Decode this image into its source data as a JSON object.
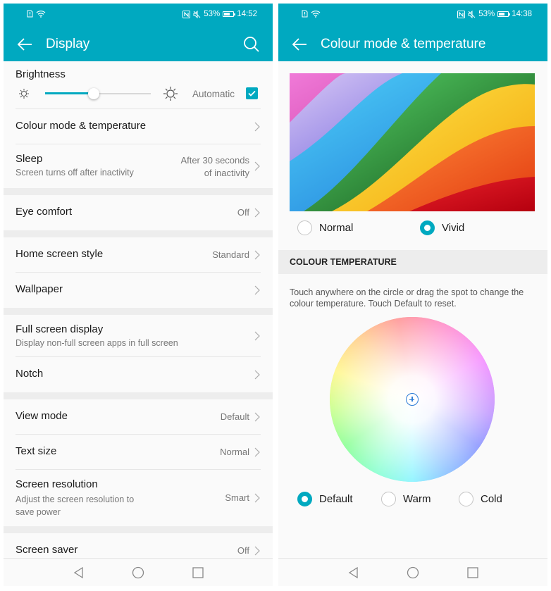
{
  "accent_color": "#00a9c0",
  "left_screen": {
    "status_bar": {
      "battery_percent": "53%",
      "time": "14:52"
    },
    "app_bar": {
      "title": "Display",
      "back_icon": "arrow-left-icon",
      "search_icon": "search-icon"
    },
    "brightness": {
      "title": "Brightness",
      "level_fraction": 0.46,
      "automatic_label": "Automatic",
      "automatic_checked": true
    },
    "rows": {
      "colour_mode": {
        "title": "Colour mode & temperature"
      },
      "sleep": {
        "title": "Sleep",
        "subtitle": "Screen turns off after inactivity",
        "value_line1": "After 30 seconds",
        "value_line2": "of inactivity"
      },
      "eye_comfort": {
        "title": "Eye comfort",
        "value": "Off"
      },
      "home_screen_style": {
        "title": "Home screen style",
        "value": "Standard"
      },
      "wallpaper": {
        "title": "Wallpaper"
      },
      "full_screen_display": {
        "title": "Full screen display",
        "subtitle": "Display non-full screen apps in full screen"
      },
      "notch": {
        "title": "Notch"
      },
      "view_mode": {
        "title": "View mode",
        "value": "Default"
      },
      "text_size": {
        "title": "Text size",
        "value": "Normal"
      },
      "screen_resolution": {
        "title": "Screen resolution",
        "subtitle_line1": "Adjust the screen resolution to",
        "subtitle_line2": "save power",
        "value": "Smart"
      },
      "screen_saver": {
        "title": "Screen saver",
        "value": "Off"
      }
    }
  },
  "right_screen": {
    "status_bar": {
      "battery_percent": "53%",
      "time": "14:38"
    },
    "app_bar": {
      "title": "Colour mode & temperature",
      "back_icon": "arrow-left-icon"
    },
    "colour_mode": {
      "options": [
        {
          "label": "Normal",
          "selected": false
        },
        {
          "label": "Vivid",
          "selected": true
        }
      ]
    },
    "section_header": "COLOUR TEMPERATURE",
    "help_text": "Touch anywhere on the circle or drag the spot to change the colour temperature. Touch Default to reset.",
    "temperature": {
      "options": [
        {
          "label": "Default",
          "selected": true
        },
        {
          "label": "Warm",
          "selected": false
        },
        {
          "label": "Cold",
          "selected": false
        }
      ]
    }
  },
  "nav_bar": {
    "back": "nav-back-icon",
    "home": "nav-home-icon",
    "recents": "nav-recents-icon"
  }
}
